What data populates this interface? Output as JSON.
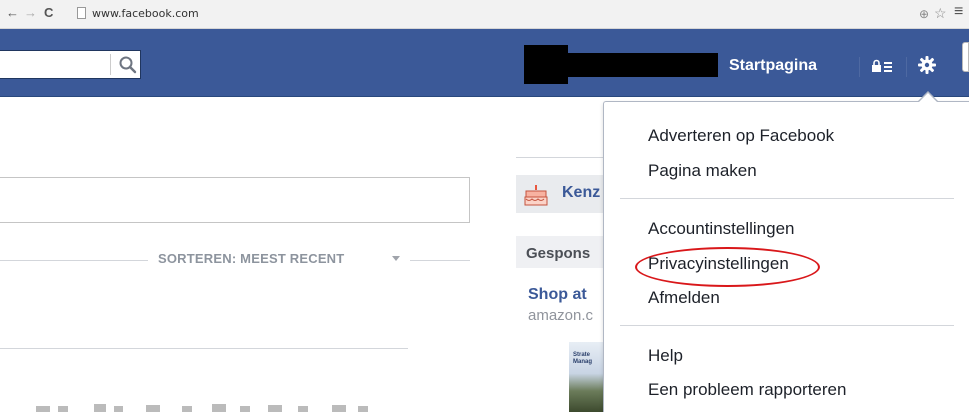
{
  "browser": {
    "url": "www.facebook.com",
    "back_icon": "arrow-left-icon",
    "forward_icon": "arrow-right-icon",
    "reload_icon": "reload-icon"
  },
  "header": {
    "home_label": "Startpagina",
    "brand_color": "#3b5998"
  },
  "feed": {
    "sort_label": "SORTEREN: MEEST RECENT"
  },
  "right_column": {
    "birthday_name": "Kenz",
    "sponsored_label": "Gespons",
    "ad_title": "Shop at",
    "ad_url": "amazon.c",
    "ad_image_text": "Strate\nManag"
  },
  "dropdown": {
    "items": [
      {
        "label": "Adverteren op Facebook"
      },
      {
        "label": "Pagina maken"
      },
      {
        "label": "Accountinstellingen"
      },
      {
        "label": "Privacyinstellingen"
      },
      {
        "label": "Afmelden"
      },
      {
        "label": "Help"
      },
      {
        "label": "Een probleem rapporteren"
      }
    ],
    "highlight_color": "#d9171a"
  }
}
